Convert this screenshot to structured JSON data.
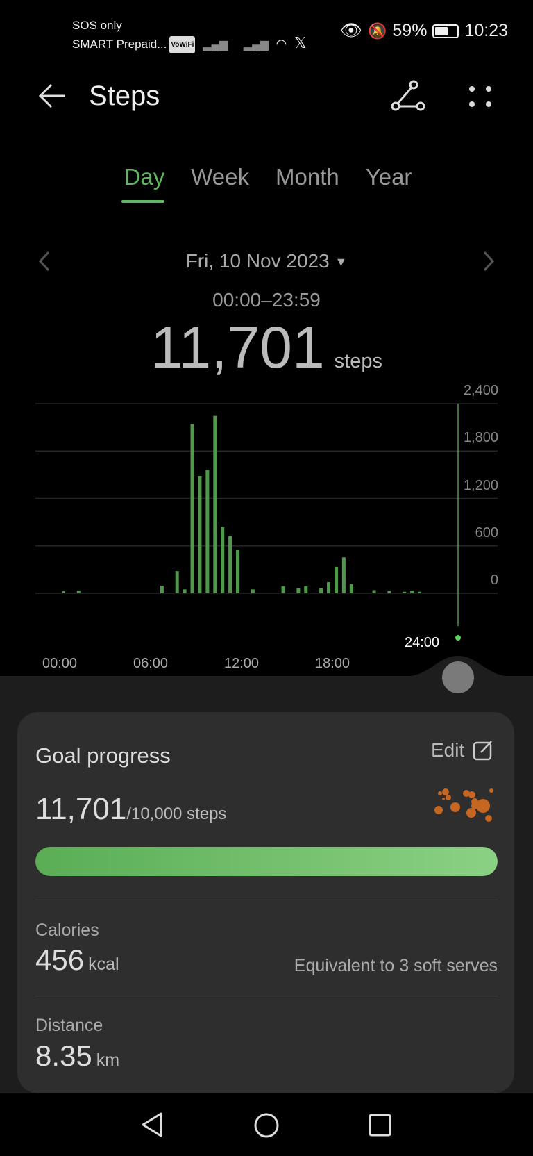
{
  "status_bar": {
    "line1": "SOS only",
    "line2": "SMART Prepaid...",
    "vowifi": "VoWiFi",
    "battery": "59%",
    "time": "10:23",
    "battery_level": 59
  },
  "header": {
    "title": "Steps"
  },
  "tabs": [
    {
      "label": "Day",
      "active": true
    },
    {
      "label": "Week"
    },
    {
      "label": "Month"
    },
    {
      "label": "Year"
    }
  ],
  "date": "Fri, 10 Nov 2023",
  "range": "00:00–23:59",
  "total": {
    "value": "11,701",
    "unit": "steps"
  },
  "chart_data": {
    "type": "bar",
    "x_unit": "time of day (30-min bins, start time)",
    "x": [
      "00:00",
      "01:00",
      "06:30",
      "07:30",
      "08:00",
      "08:30",
      "09:00",
      "09:30",
      "10:00",
      "10:30",
      "11:00",
      "11:30",
      "12:30",
      "14:30",
      "15:30",
      "16:00",
      "17:00",
      "17:30",
      "18:00",
      "18:30",
      "19:00",
      "20:30",
      "21:30",
      "22:30",
      "23:00",
      "23:30"
    ],
    "values": [
      25,
      35,
      95,
      280,
      50,
      2140,
      1485,
      1560,
      2245,
      840,
      725,
      550,
      50,
      90,
      65,
      90,
      65,
      140,
      335,
      455,
      115,
      40,
      30,
      20,
      35,
      20
    ],
    "yticks": [
      "2,400",
      "1,800",
      "1,200",
      "600",
      "0"
    ],
    "ylim": [
      0,
      2400
    ],
    "xticks": [
      "00:00",
      "06:00",
      "12:00",
      "18:00"
    ],
    "cursor_label": "24:00",
    "grid": true,
    "bar_color": "#4f9a4a"
  },
  "goal": {
    "title": "Goal progress",
    "edit": "Edit",
    "value": "11,701",
    "target": "/10,000 steps",
    "progress": 1.0,
    "accent": "#5fb85f"
  },
  "calories": {
    "label": "Calories",
    "value": "456",
    "unit": "kcal",
    "note": "Equivalent to 3 soft serves"
  },
  "distance": {
    "label": "Distance",
    "value": "8.35",
    "unit": "km"
  }
}
